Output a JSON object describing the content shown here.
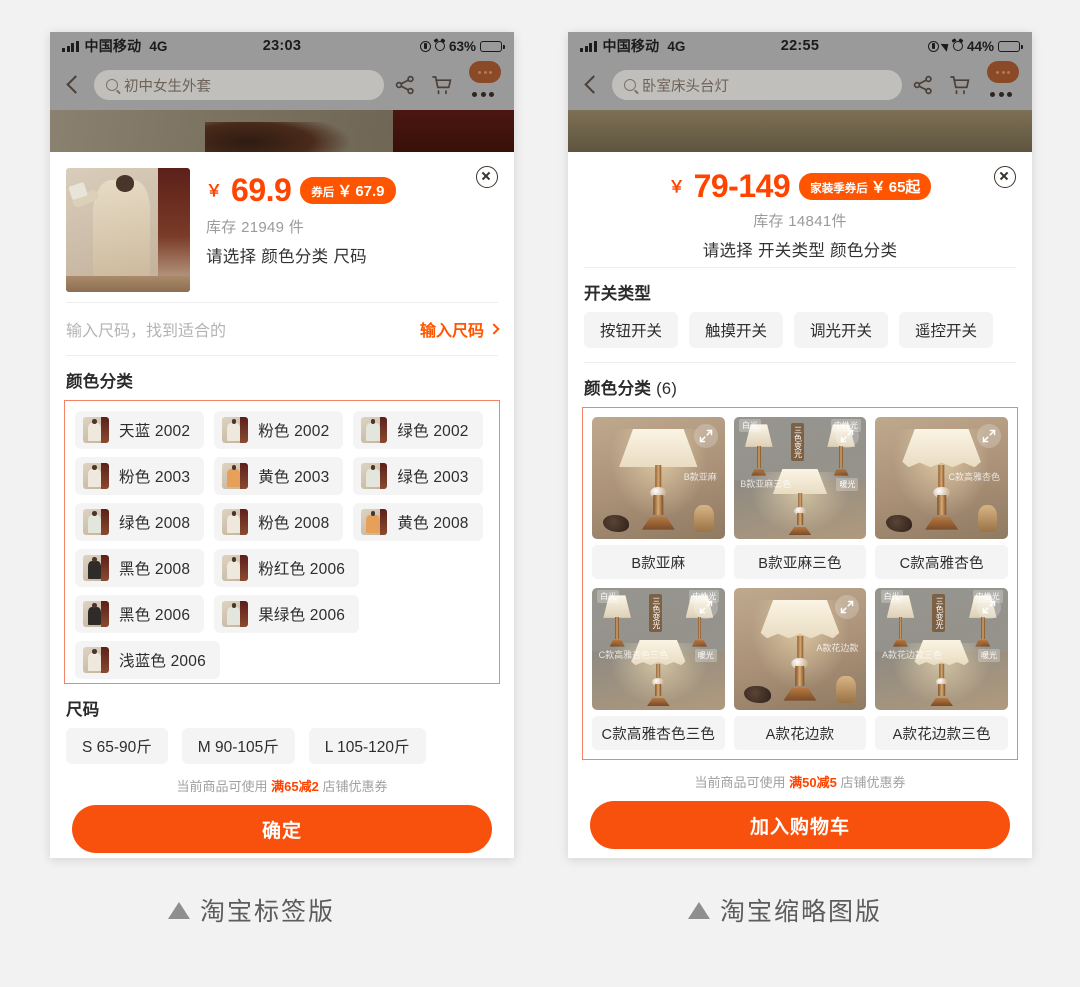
{
  "page": {
    "background": "#f2f2f2",
    "accent": "#ff4400",
    "cta_color": "#f8510d",
    "highlight_box_color": "#f4836a"
  },
  "left_phone": {
    "status_bar": {
      "carrier": "中国移动",
      "network": "4G",
      "time": "23:03",
      "battery_percent": "63%",
      "icons": [
        "signal-bars-icon",
        "lock-rotation-icon",
        "alarm-icon",
        "battery-icon"
      ]
    },
    "nav": {
      "back_icon": "chevron-left-icon",
      "search_value": "初中女生外套",
      "search_icon": "search-icon",
      "share_icon": "share-icon",
      "cart_icon": "cart-icon",
      "more_icon": "more-dots-icon"
    },
    "product": {
      "currency": "￥",
      "price": "69.9",
      "coupon_prefix": "券后",
      "coupon_currency": "￥",
      "coupon_price": "67.9",
      "stock": "库存 21949 件",
      "choose_hint": "请选择 颜色分类 尺码",
      "close_icon": "close-circle-icon",
      "thumbnail": "product-photo"
    },
    "size_finder": {
      "hint": "输入尺码，找到适合的",
      "action": "输入尺码",
      "chevron_icon": "chevron-right-icon"
    },
    "color_section": {
      "title": "颜色分类",
      "options": [
        "天蓝 2002",
        "粉色 2002",
        "绿色 2002",
        "粉色 2003",
        "黄色 2003",
        "绿色 2003",
        "绿色 2008",
        "粉色 2008",
        "黄色 2008",
        "黑色 2008",
        "粉红色 2006",
        "黑色 2006",
        "果绿色 2006",
        "浅蓝色 2006"
      ]
    },
    "size_section": {
      "title": "尺码",
      "options": [
        "S 65-90斤",
        "M 90-105斤",
        "L 105-120斤"
      ]
    },
    "coupon_note": {
      "prefix": "当前商品可使用 ",
      "highlight": "满65减2",
      "suffix": " 店铺优惠券"
    },
    "cta_label": "确定",
    "caption": "淘宝标签版"
  },
  "right_phone": {
    "status_bar": {
      "carrier": "中国移动",
      "network": "4G",
      "time": "22:55",
      "battery_percent": "44%",
      "icons": [
        "signal-bars-icon",
        "lock-rotation-icon",
        "location-icon",
        "alarm-icon",
        "battery-icon"
      ]
    },
    "nav": {
      "back_icon": "chevron-left-icon",
      "search_value": "卧室床头台灯",
      "search_icon": "search-icon",
      "share_icon": "share-icon",
      "cart_icon": "cart-icon",
      "more_icon": "more-dots-icon"
    },
    "product": {
      "currency": "￥",
      "price": "79-149",
      "coupon_prefix": "家装季券后",
      "coupon_currency": "￥",
      "coupon_price": "65起",
      "stock": "库存 14841件",
      "choose_hint": "请选择 开关类型 颜色分类",
      "close_icon": "close-circle-icon"
    },
    "switch_section": {
      "title": "开关类型",
      "options": [
        "按钮开关",
        "触摸开关",
        "调光开关",
        "遥控开关"
      ]
    },
    "color_section": {
      "title": "颜色分类",
      "count": "(6)",
      "options": [
        {
          "label": "B款亚麻",
          "style": "single",
          "watermark": "B款亚麻",
          "expand_icon": "expand-icon"
        },
        {
          "label": "B款亚麻三色",
          "style": "triple",
          "watermark": "三色变光",
          "expand_icon": "expand-icon"
        },
        {
          "label": "C款高雅杏色",
          "style": "single",
          "watermark": "C款高雅杏色",
          "expand_icon": "expand-icon"
        },
        {
          "label": "C款高雅杏色三色",
          "style": "triple",
          "watermark": "三色变光",
          "expand_icon": "expand-icon"
        },
        {
          "label": "A款花边款",
          "style": "single",
          "watermark": "A款花边款",
          "expand_icon": "expand-icon"
        },
        {
          "label": "A款花边款三色",
          "style": "triple",
          "watermark": "三色变光",
          "expand_icon": "expand-icon"
        }
      ]
    },
    "coupon_note": {
      "prefix": "当前商品可使用 ",
      "highlight": "满50减5",
      "suffix": " 店铺优惠券"
    },
    "cta_label": "加入购物车",
    "caption": "淘宝缩略图版"
  }
}
